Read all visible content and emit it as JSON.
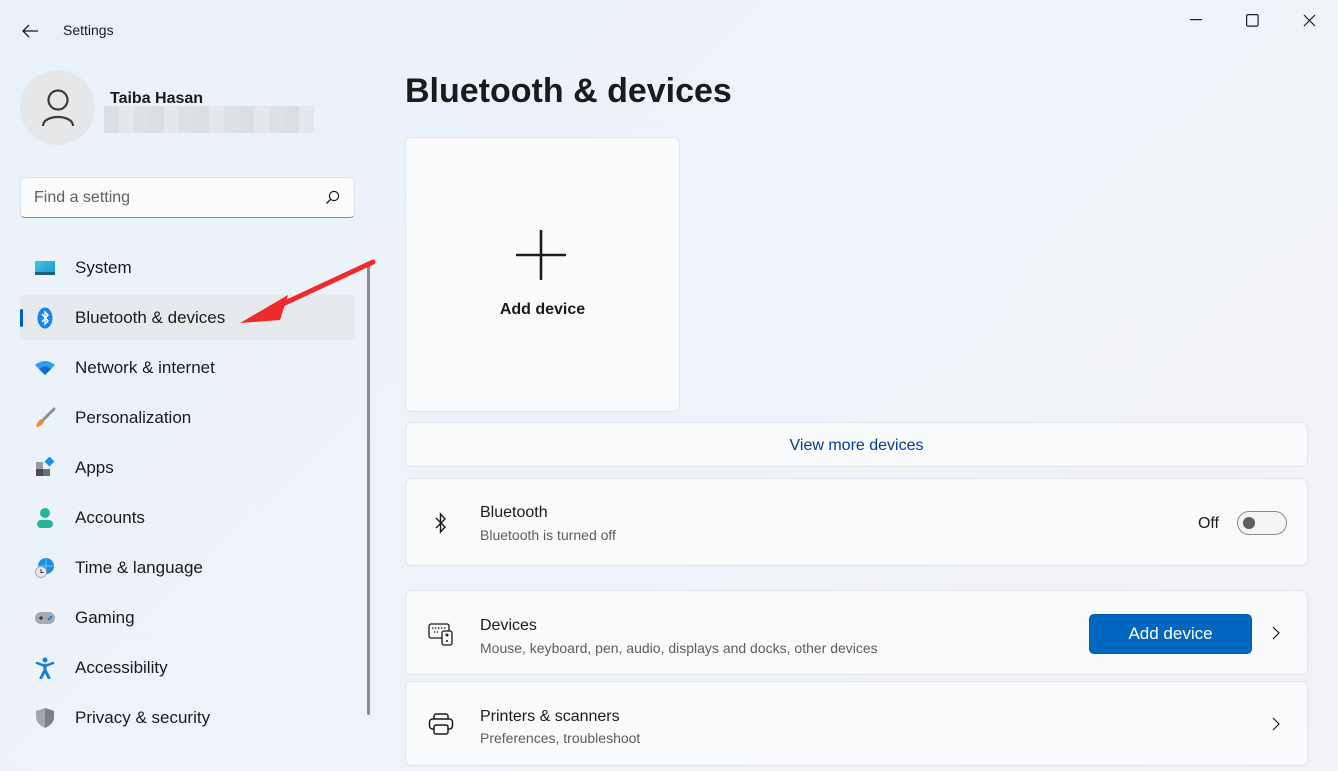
{
  "window": {
    "title": "Settings",
    "controls": [
      "minimize",
      "maximize",
      "close"
    ]
  },
  "profile": {
    "name": "Taiba Hasan",
    "email_redacted": true
  },
  "search": {
    "placeholder": "Find a setting",
    "value": ""
  },
  "sidebar": {
    "active_index": 1,
    "items": [
      {
        "label": "System",
        "icon": "system-icon"
      },
      {
        "label": "Bluetooth & devices",
        "icon": "bluetooth-icon"
      },
      {
        "label": "Network & internet",
        "icon": "wifi-icon"
      },
      {
        "label": "Personalization",
        "icon": "paintbrush-icon"
      },
      {
        "label": "Apps",
        "icon": "apps-icon"
      },
      {
        "label": "Accounts",
        "icon": "accounts-icon"
      },
      {
        "label": "Time & language",
        "icon": "time-language-icon"
      },
      {
        "label": "Gaming",
        "icon": "gamepad-icon"
      },
      {
        "label": "Accessibility",
        "icon": "accessibility-icon"
      },
      {
        "label": "Privacy & security",
        "icon": "shield-icon"
      }
    ]
  },
  "main": {
    "title": "Bluetooth & devices",
    "add_tile_label": "Add device",
    "view_more_label": "View more devices",
    "bluetooth": {
      "title": "Bluetooth",
      "subtitle": "Bluetooth is turned off",
      "state_label": "Off",
      "enabled": false
    },
    "devices": {
      "title": "Devices",
      "subtitle": "Mouse, keyboard, pen, audio, displays and docks, other devices",
      "button_label": "Add device"
    },
    "printers": {
      "title": "Printers & scanners",
      "subtitle": "Preferences, troubleshoot"
    }
  },
  "colors": {
    "accent": "#0067c0",
    "link": "#003e92",
    "annotation": "#ee2a2a"
  }
}
